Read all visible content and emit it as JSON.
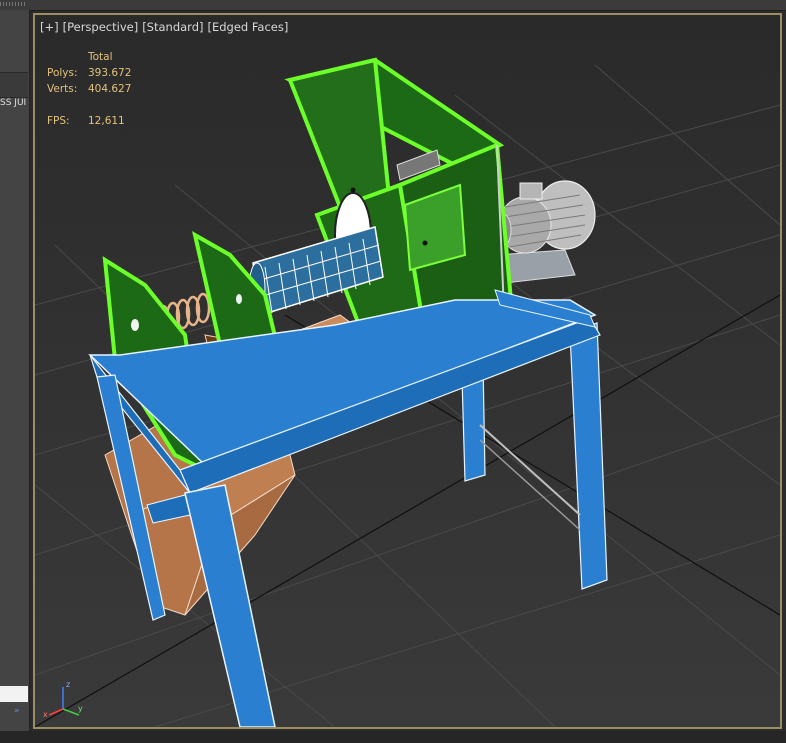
{
  "viewport": {
    "labels": [
      "[+]",
      "[Perspective]",
      "[Standard]",
      "[Edged Faces]"
    ]
  },
  "stats": {
    "header": "Total",
    "polys_label": "Polys:",
    "polys_value": "393.672",
    "verts_label": "Verts:",
    "verts_value": "404.627",
    "fps_label": "FPS:",
    "fps_value": "12,611"
  },
  "left_panel": {
    "tab_text": "SS JUI"
  },
  "gizmo": {
    "x": "x",
    "y": "y",
    "z": "z"
  },
  "colors": {
    "viewport_border": "#9c8d62",
    "stats_text": "#e3c27a",
    "frame_blue": "#2a7fd0",
    "plate_green": "#1d6a16",
    "selection_green": "#6cff2a",
    "chute_copper": "#c98a5c"
  },
  "icons": [
    "axis-gizmo-icon",
    "chevron-right-icon"
  ]
}
